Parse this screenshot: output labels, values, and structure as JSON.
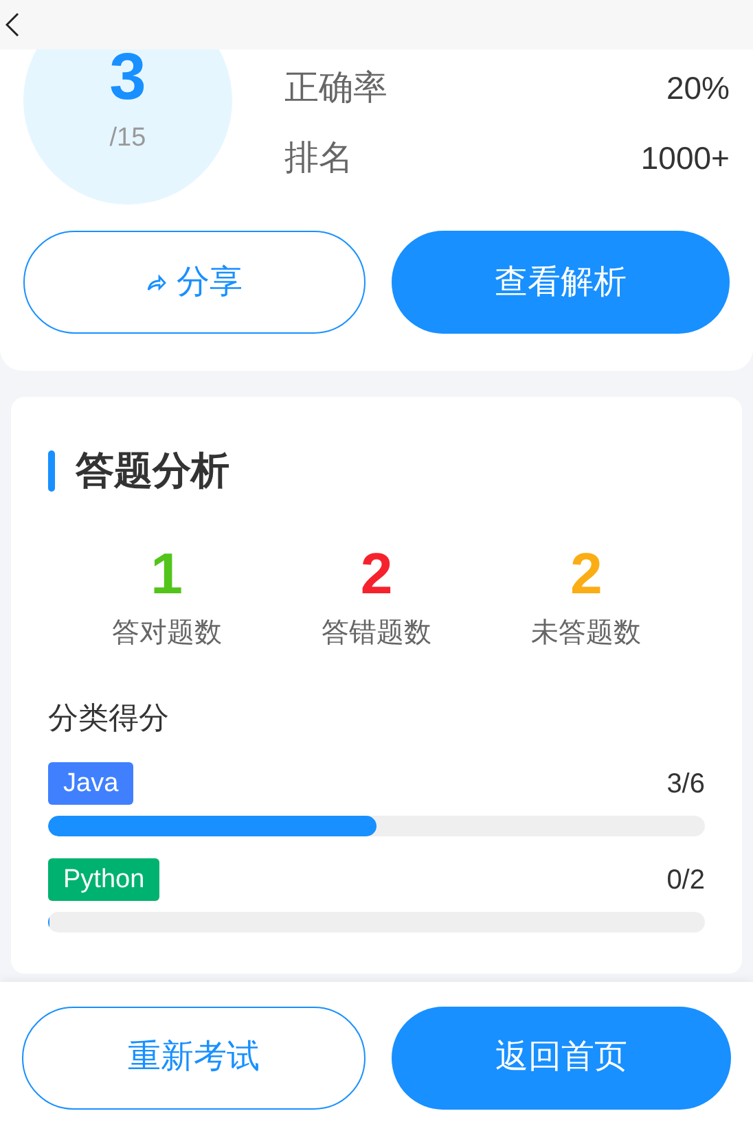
{
  "score": {
    "value": "3",
    "total": "/15",
    "stats": [
      {
        "label": "正确率",
        "value": "20%"
      },
      {
        "label": "排名",
        "value": "1000+"
      }
    ],
    "buttons": [
      {
        "label": "分享",
        "kind": "share"
      },
      {
        "label": "查看解析",
        "kind": "solid"
      }
    ]
  },
  "analysis": {
    "title": "答题分析",
    "counts": [
      {
        "value": "1",
        "label": "答对题数",
        "color": "#52c41a"
      },
      {
        "value": "2",
        "label": "答错题数",
        "color": "#f5222d"
      },
      {
        "value": "2",
        "label": "未答题数",
        "color": "#faad14"
      }
    ],
    "category_title": "分类得分",
    "categories": [
      {
        "tag": "Java",
        "color": "#4080ff",
        "score": "3/6",
        "level": 0.5
      },
      {
        "tag": "Python",
        "color": "#00b26f",
        "score": "0/2",
        "level": 0
      }
    ]
  },
  "footer": {
    "buttons": [
      {
        "label": "重新考试",
        "kind": "outline"
      },
      {
        "label": "返回首页",
        "kind": "solid"
      }
    ]
  }
}
